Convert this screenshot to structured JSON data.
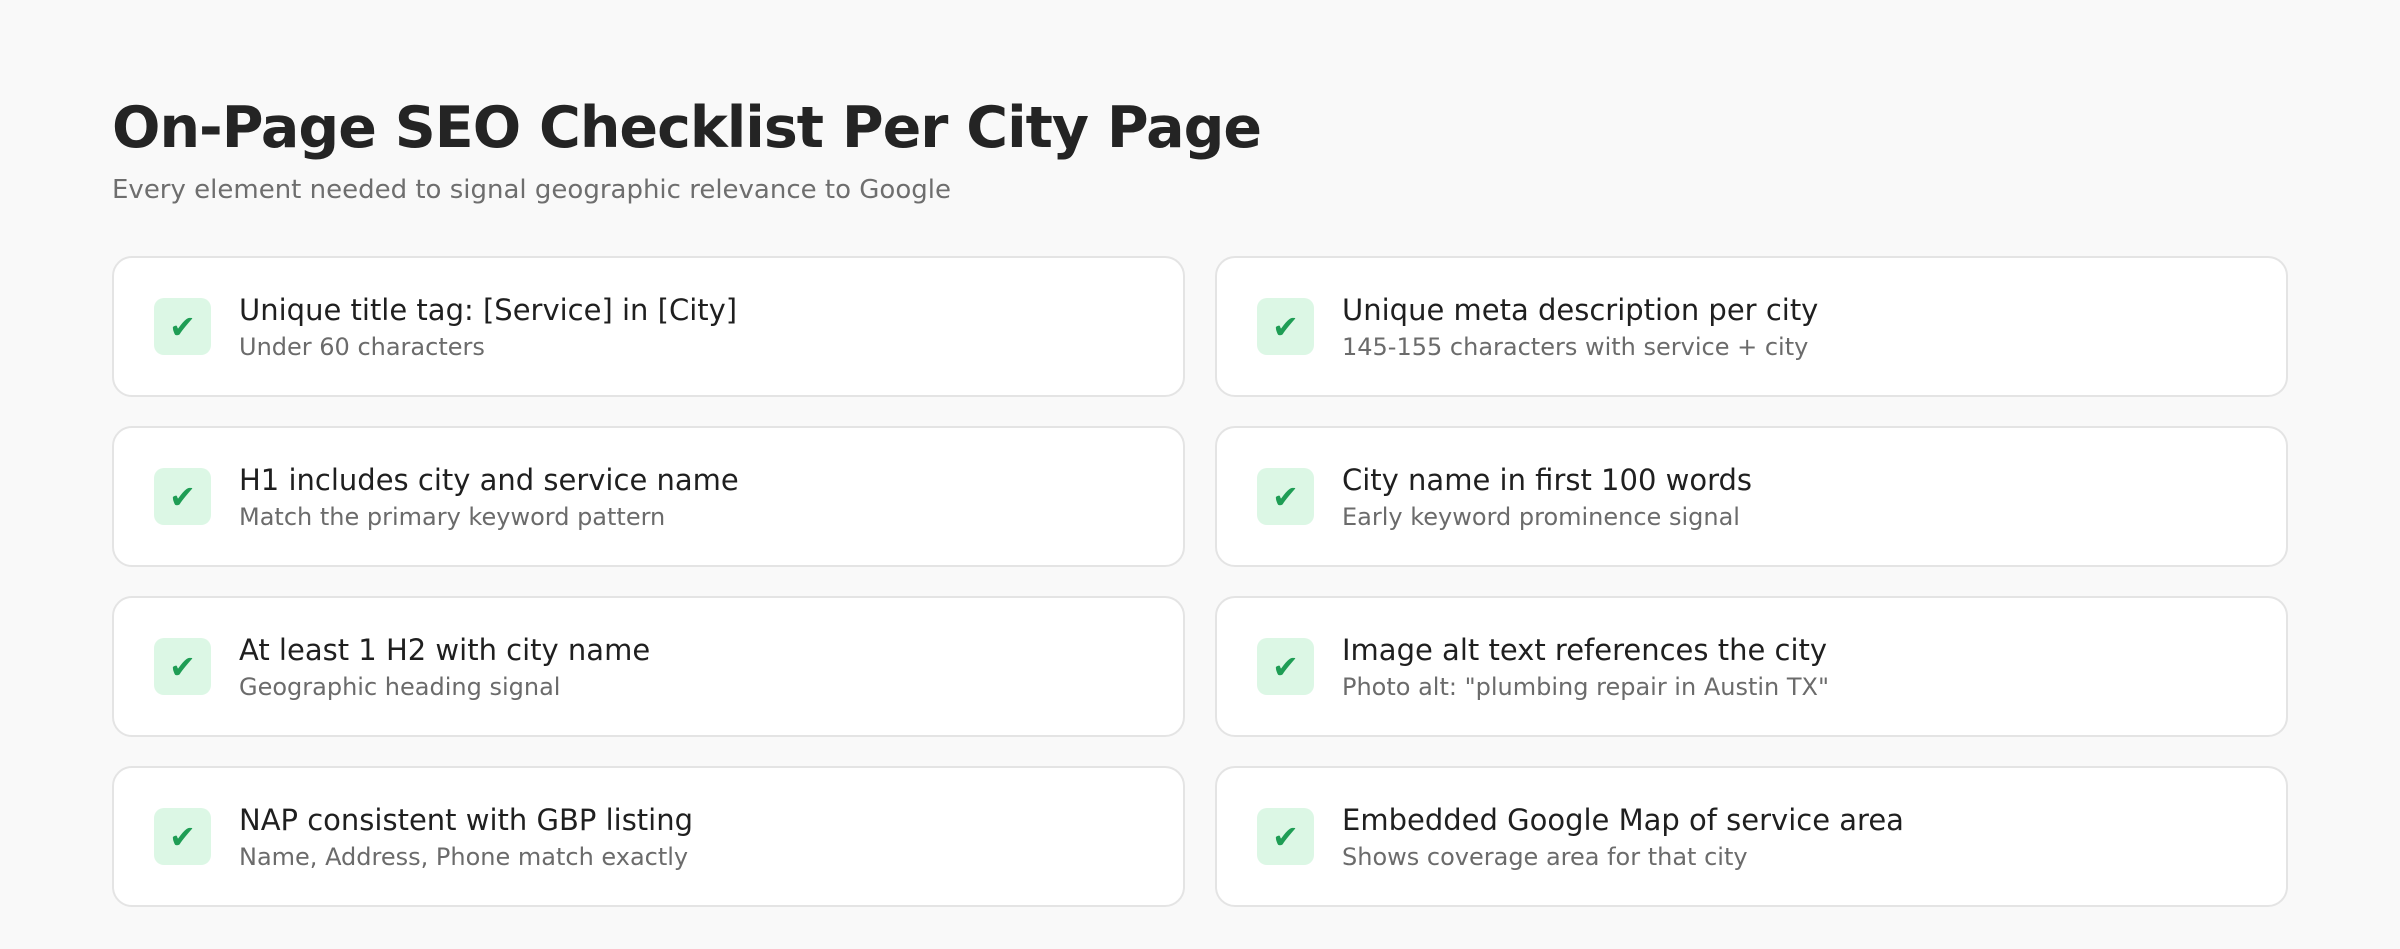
{
  "page": {
    "title": "On-Page SEO Checklist Per City Page",
    "subtitle": "Every element needed to signal geographic relevance to Google"
  },
  "theme": {
    "check_bg": "#dcf7e5",
    "check_color": "#1f9d55"
  },
  "checklist": [
    {
      "icon": "checkmark-icon",
      "glyph": "✔",
      "title": "Unique title tag: [Service] in [City]",
      "desc": "Under 60 characters"
    },
    {
      "icon": "checkmark-icon",
      "glyph": "✔",
      "title": "Unique meta description per city",
      "desc": "145-155 characters with service + city"
    },
    {
      "icon": "checkmark-icon",
      "glyph": "✔",
      "title": "H1 includes city and service name",
      "desc": "Match the primary keyword pattern"
    },
    {
      "icon": "checkmark-icon",
      "glyph": "✔",
      "title": "City name in first 100 words",
      "desc": "Early keyword prominence signal"
    },
    {
      "icon": "checkmark-icon",
      "glyph": "✔",
      "title": "At least 1 H2 with city name",
      "desc": "Geographic heading signal"
    },
    {
      "icon": "checkmark-icon",
      "glyph": "✔",
      "title": "Image alt text references the city",
      "desc": "Photo alt: \"plumbing repair in Austin TX\""
    },
    {
      "icon": "checkmark-icon",
      "glyph": "✔",
      "title": "NAP consistent with GBP listing",
      "desc": "Name, Address, Phone match exactly"
    },
    {
      "icon": "checkmark-icon",
      "glyph": "✔",
      "title": "Embedded Google Map of service area",
      "desc": "Shows coverage area for that city"
    }
  ]
}
